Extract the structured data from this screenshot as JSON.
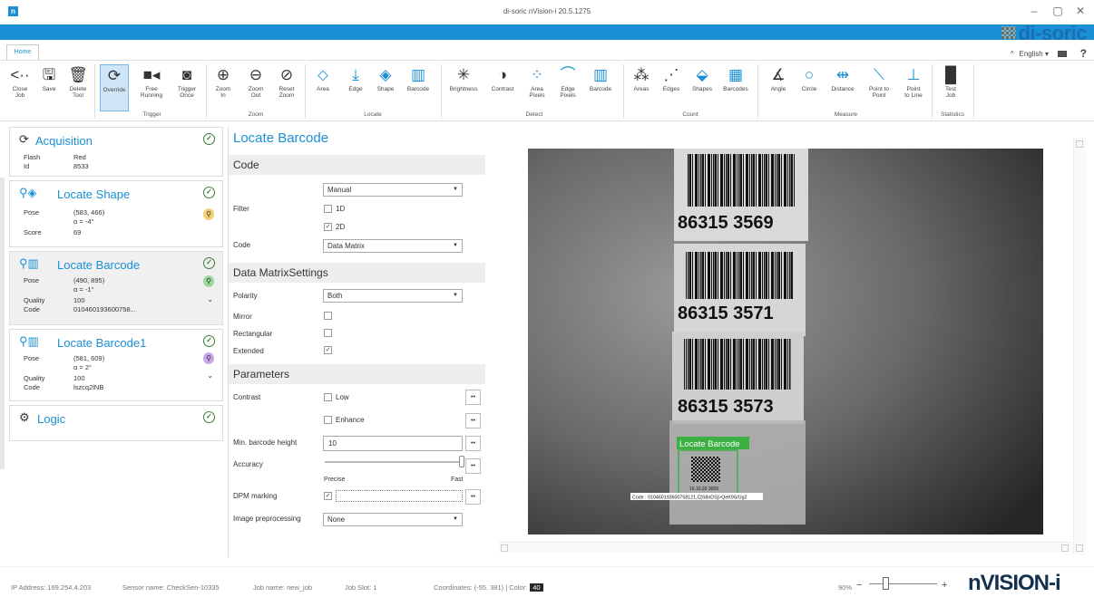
{
  "window": {
    "title": "di-soric nVision-i 20.5.1275",
    "icon_letter": "n",
    "minimize": "–",
    "maximize": "▢",
    "close": "✕",
    "brand_logo": "di-soric",
    "brand_color": "#1a6fb0",
    "accent_color": "#1a8fd6"
  },
  "tabs": {
    "home": "Home"
  },
  "topright": {
    "language": "English",
    "help": "?"
  },
  "ribbon": {
    "close_job": "Close\nJob",
    "save": "Save",
    "delete_tool": "Delete\nTool",
    "override": "Override",
    "free_running": "Free\nRunning",
    "trigger_once": "Trigger\nOnce",
    "zoom_in": "Zoom\nIn",
    "zoom_out": "Zoom\nOut",
    "reset_zoom": "Reset\nZoom",
    "area": "Area",
    "edge": "Edge",
    "shape": "Shape",
    "barcode": "Barcode",
    "brightness": "Brightness",
    "contrast": "Contrast",
    "area_pixels": "Area\nPixels",
    "edge_pixels": "Edge\nPixels",
    "barcode_detect": "Barcode",
    "areas": "Areas",
    "edges": "Edges",
    "shapes": "Shapes",
    "barcodes": "Barcodes",
    "angle": "Angle",
    "circle": "Circle",
    "distance": "Distance",
    "point_to_point": "Point to\nPoint",
    "point_to_line": "Point\nto Line",
    "test_job": "Test\nJob",
    "groups": {
      "trigger": "Trigger",
      "zoom": "Zoom",
      "locate": "Locate",
      "detect": "Detect",
      "count": "Count",
      "measure": "Measure",
      "statistics": "Statistics"
    }
  },
  "tools": [
    {
      "title": "Acquisition",
      "rows": [
        [
          "Flash",
          "Red"
        ],
        [
          "Id",
          "8533"
        ]
      ]
    },
    {
      "title": "Locate Shape",
      "rows": [
        [
          "Pose",
          "(583, 466)"
        ],
        [
          "",
          "α = -4°"
        ],
        [
          "Score",
          "69"
        ]
      ]
    },
    {
      "title": "Locate Barcode",
      "rows": [
        [
          "Pose",
          "(490, 895)"
        ],
        [
          "",
          "α = -1°"
        ],
        [
          "Quality",
          "100"
        ],
        [
          "Code",
          "010460193600758..."
        ]
      ]
    },
    {
      "title": "Locate Barcode1",
      "rows": [
        [
          "Pose",
          "(581, 609)"
        ],
        [
          "",
          "α = 2°"
        ],
        [
          "Quality",
          "100"
        ],
        [
          "Code",
          "lszcq2lNB"
        ]
      ]
    },
    {
      "title": "Logic",
      "rows": []
    }
  ],
  "props": {
    "title": "Locate Barcode",
    "code_section": "Code",
    "mode_value": "Manual",
    "filter_label": "Filter",
    "filter_1d": "1D",
    "filter_2d": "2D",
    "code_label": "Code",
    "code_value": "Data Matrix",
    "dm_section": "Data MatrixSettings",
    "polarity_label": "Polarity",
    "polarity_value": "Both",
    "mirror_label": "Mirror",
    "rectangular_label": "Rectangular",
    "extended_label": "Extended",
    "params_section": "Parameters",
    "contrast_label": "Contrast",
    "contrast_low": "Low",
    "contrast_enhance": "Enhance",
    "min_height_label": "Min. barcode height",
    "min_height_value": "10",
    "accuracy_label": "Accuracy",
    "accuracy_min": "Precise",
    "accuracy_max": "Fast",
    "accuracy_level": 1.0,
    "dpm_label": "DPM marking",
    "preproc_label": "Image preprocessing",
    "preproc_value": "None",
    "check": "✓",
    "step_btn": "••"
  },
  "image": {
    "labels": [
      "86315 3569",
      "86315 3571",
      "86315 3573"
    ],
    "overlay_label": "Locate Barcode",
    "overlay_code": "Code : 010460193600758121,C[S8nDS]>QeK9S/Ug2",
    "dm_text": "16.10.20 3009"
  },
  "status": {
    "ip": "IP Address:  169.254.4.203",
    "sensor": "Sensor name:  CheckSen-10335",
    "job": "Job name:  new_job",
    "slot": "Job Slot:  1",
    "coords": "Coordinates: (-55, 381) | Color:",
    "color_value": "40",
    "zoom": "90%",
    "minus": "−",
    "plus": "+",
    "product_logo": "nVISION-i"
  }
}
